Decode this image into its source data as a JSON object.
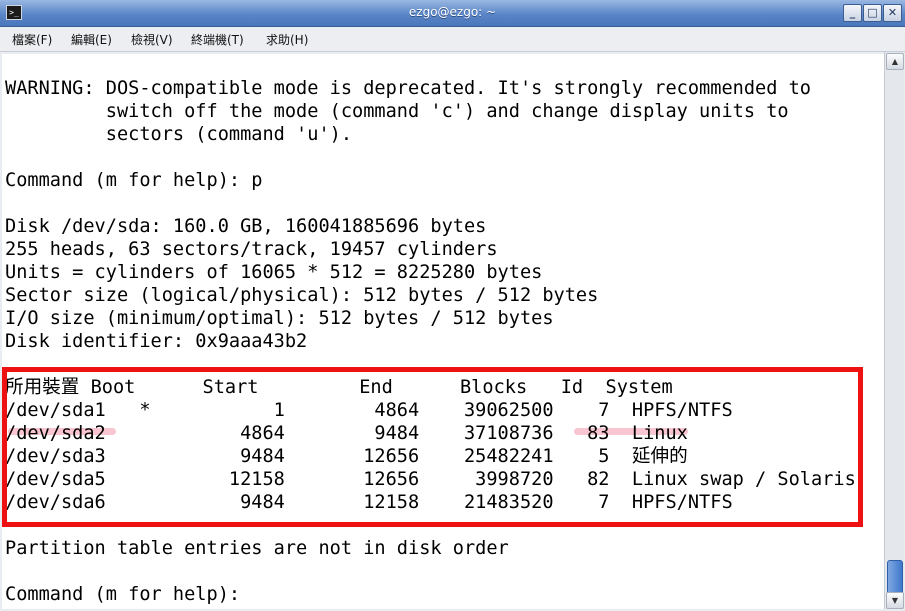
{
  "window": {
    "title": "ezgo@ezgo: ~",
    "controls": {
      "minimize": "_",
      "maximize": "□",
      "close": "✕"
    },
    "icon": "terminal-icon"
  },
  "menubar": {
    "items": [
      {
        "label": "檔案(F)"
      },
      {
        "label": "編輯(E)"
      },
      {
        "label": "檢視(V)"
      },
      {
        "label": "終端機(T)"
      },
      {
        "label": "求助(H)"
      }
    ]
  },
  "terminal": {
    "lines": [
      "WARNING: DOS-compatible mode is deprecated. It's strongly recommended to",
      "         switch off the mode (command 'c') and change display units to",
      "         sectors (command 'u').",
      "",
      "Command (m for help): p",
      "",
      "Disk /dev/sda: 160.0 GB, 160041885696 bytes",
      "255 heads, 63 sectors/track, 19457 cylinders",
      "Units = cylinders of 16065 * 512 = 8225280 bytes",
      "Sector size (logical/physical): 512 bytes / 512 bytes",
      "I/O size (minimum/optimal): 512 bytes / 512 bytes",
      "Disk identifier: 0x9aaa43b2",
      "",
      "所用裝置 Boot      Start         End      Blocks   Id  System",
      "/dev/sda1   *           1        4864    39062500    7  HPFS/NTFS",
      "/dev/sda2            4864        9484    37108736   83  Linux",
      "/dev/sda3            9484       12656    25482241    5  延伸的",
      "/dev/sda5           12158       12656     3998720   82  Linux swap / Solaris",
      "/dev/sda6            9484       12158    21483520    7  HPFS/NTFS",
      "",
      "Partition table entries are not in disk order",
      "",
      "Command (m for help): "
    ]
  },
  "colors": {
    "highlight_box": "#ee1111",
    "strike_marker": "#f496aa"
  }
}
